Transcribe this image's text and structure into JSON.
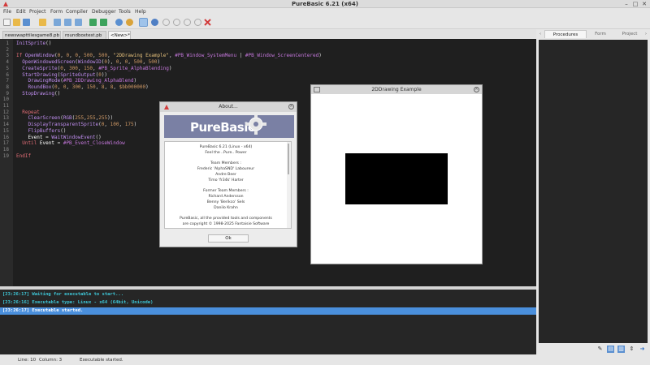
{
  "window": {
    "title": "PureBasic 6.21 (x64)",
    "close_glyph": "✕",
    "max_glyph": "□",
    "min_glyph": "–"
  },
  "menu": [
    "File",
    "Edit",
    "Project",
    "Form",
    "Compiler",
    "Debugger",
    "Tools",
    "Help"
  ],
  "toolbar_icons": [
    "new-file-icon",
    "open-file-icon",
    "save-icon",
    "save-all-icon",
    "close-file-icon",
    "cut-icon",
    "copy-icon",
    "paste-icon",
    "undo-icon",
    "redo-icon",
    "compile-run-icon",
    "debugger-icon",
    "stop-icon",
    "step-icon",
    "step-over-icon",
    "step-out-icon",
    "kill-icon"
  ],
  "file_tabs": [
    "newswapttilesgame8.pb",
    "roundboxtest.pb",
    "<New>*"
  ],
  "code_lines": [
    {
      "n": "1",
      "t": [
        [
          "fn",
          "InitSprite"
        ],
        [
          "op",
          "()"
        ]
      ]
    },
    {
      "n": "2",
      "t": []
    },
    {
      "n": "3",
      "t": [
        [
          "kw",
          "If "
        ],
        [
          "fn",
          "OpenWindow"
        ],
        [
          "op",
          "("
        ],
        [
          "num",
          "0"
        ],
        [
          "op",
          ", "
        ],
        [
          "num",
          "0"
        ],
        [
          "op",
          ", "
        ],
        [
          "num",
          "0"
        ],
        [
          "op",
          ", "
        ],
        [
          "num",
          "500"
        ],
        [
          "op",
          ", "
        ],
        [
          "num",
          "500"
        ],
        [
          "op",
          ", "
        ],
        [
          "str",
          "\"2DDrawing Example\""
        ],
        [
          "op",
          ", "
        ],
        [
          "cst",
          "#PB_Window_SystemMenu"
        ],
        [
          "op",
          " | "
        ],
        [
          "cst",
          "#PB_Window_ScreenCentered"
        ],
        [
          "op",
          ")"
        ]
      ]
    },
    {
      "n": "4",
      "t": [
        [
          "fn",
          "  OpenWindowedScreen"
        ],
        [
          "op",
          "("
        ],
        [
          "fn",
          "WindowID"
        ],
        [
          "op",
          "("
        ],
        [
          "num",
          "0"
        ],
        [
          "op",
          "), "
        ],
        [
          "num",
          "0"
        ],
        [
          "op",
          ", "
        ],
        [
          "num",
          "0"
        ],
        [
          "op",
          ", "
        ],
        [
          "num",
          "500"
        ],
        [
          "op",
          ", "
        ],
        [
          "num",
          "500"
        ],
        [
          "op",
          ")"
        ]
      ]
    },
    {
      "n": "5",
      "t": [
        [
          "fn",
          "  CreateSprite"
        ],
        [
          "op",
          "("
        ],
        [
          "num",
          "0"
        ],
        [
          "op",
          ", "
        ],
        [
          "num",
          "300"
        ],
        [
          "op",
          ", "
        ],
        [
          "num",
          "150"
        ],
        [
          "op",
          ", "
        ],
        [
          "cst",
          "#PB_Sprite_AlphaBlending"
        ],
        [
          "op",
          ")"
        ]
      ]
    },
    {
      "n": "6",
      "t": [
        [
          "fn",
          "  StartDrawing"
        ],
        [
          "op",
          "("
        ],
        [
          "fn",
          "SpriteOutput"
        ],
        [
          "op",
          "("
        ],
        [
          "num",
          "0"
        ],
        [
          "op",
          "))"
        ]
      ]
    },
    {
      "n": "7",
      "t": [
        [
          "fn",
          "    DrawingMode"
        ],
        [
          "op",
          "("
        ],
        [
          "cst",
          "#PB_2DDrawing_AlphaBlend"
        ],
        [
          "op",
          ")"
        ]
      ]
    },
    {
      "n": "8",
      "t": [
        [
          "fn",
          "    RoundBox"
        ],
        [
          "op",
          "("
        ],
        [
          "num",
          "0"
        ],
        [
          "op",
          ", "
        ],
        [
          "num",
          "0"
        ],
        [
          "op",
          ", "
        ],
        [
          "num",
          "300"
        ],
        [
          "op",
          ", "
        ],
        [
          "num",
          "150"
        ],
        [
          "op",
          ", "
        ],
        [
          "num",
          "8"
        ],
        [
          "op",
          ", "
        ],
        [
          "num",
          "8"
        ],
        [
          "op",
          ", "
        ],
        [
          "num",
          "$bb000000"
        ],
        [
          "op",
          ")"
        ]
      ]
    },
    {
      "n": "9",
      "t": [
        [
          "fn",
          "  StopDrawing"
        ],
        [
          "op",
          "()"
        ]
      ]
    },
    {
      "n": "10",
      "t": []
    },
    {
      "n": "11",
      "t": []
    },
    {
      "n": "12",
      "t": [
        [
          "kw",
          "  Repeat"
        ]
      ]
    },
    {
      "n": "13",
      "t": [
        [
          "fn",
          "    ClearScreen"
        ],
        [
          "op",
          "("
        ],
        [
          "fn",
          "RGB"
        ],
        [
          "op",
          "("
        ],
        [
          "num",
          "255"
        ],
        [
          "op",
          ","
        ],
        [
          "num",
          "255"
        ],
        [
          "op",
          ","
        ],
        [
          "num",
          "255"
        ],
        [
          "op",
          "))"
        ]
      ]
    },
    {
      "n": "14",
      "t": [
        [
          "fn",
          "    DisplayTransparentSprite"
        ],
        [
          "op",
          "("
        ],
        [
          "num",
          "0"
        ],
        [
          "op",
          ", "
        ],
        [
          "num",
          "100"
        ],
        [
          "op",
          ", "
        ],
        [
          "num",
          "175"
        ],
        [
          "op",
          ")"
        ]
      ]
    },
    {
      "n": "15",
      "t": [
        [
          "fn",
          "    FlipBuffers"
        ],
        [
          "op",
          "()"
        ]
      ]
    },
    {
      "n": "16",
      "t": [
        [
          "var",
          "    Event "
        ],
        [
          "op",
          "= "
        ],
        [
          "fn",
          "WaitWindowEvent"
        ],
        [
          "op",
          "()"
        ]
      ]
    },
    {
      "n": "17",
      "t": [
        [
          "kw",
          "  Until "
        ],
        [
          "var",
          "Event "
        ],
        [
          "op",
          "= "
        ],
        [
          "cst",
          "#PB_Event_CloseWindow"
        ]
      ]
    },
    {
      "n": "18",
      "t": []
    },
    {
      "n": "19",
      "t": [
        [
          "kw",
          "EndIf"
        ]
      ]
    }
  ],
  "output_lines": [
    {
      "text": "[23:26:17] Waiting for executable to start...",
      "selected": false
    },
    {
      "text": "[23:26:16] Executable type: Linux - x64  (64bit, Unicode)",
      "selected": false
    },
    {
      "text": "[23:26:17] Executable started.",
      "selected": true
    }
  ],
  "status": {
    "line": "Line: 10",
    "column": "Column: 3",
    "message": "Executable started."
  },
  "right_panel": {
    "tabs": [
      "Procedures",
      "Form",
      "Project"
    ],
    "nav_left": "‹",
    "nav_right": "›"
  },
  "about": {
    "title": "About...",
    "logo_text": "PureBasic",
    "lines": [
      "PureBasic 6.21 (Linux - x64)",
      "Feel the ..Pure.. Power",
      "",
      "Team Members :",
      "Frederic 'AlphaSND' Laboureur",
      "Andre Beer",
      "Timo 'fr34k' Harter",
      "",
      "Former Team Members :",
      "Richard Andersson",
      "Benny 'Berikco' Sels",
      "Danilo Krahn",
      "",
      "PureBasic, all the provided tools and components",
      "are copyright © 1998-2025 Fantaisie Software"
    ],
    "ok_label": "Ok"
  },
  "drawing_window": {
    "title": "2DDrawing Example"
  }
}
